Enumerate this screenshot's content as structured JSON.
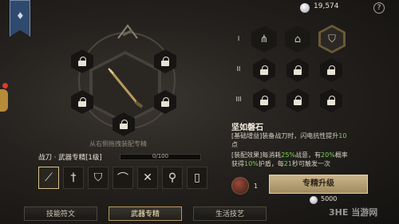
{
  "currency": {
    "value": "19,574",
    "icon": "silver-coin-icon"
  },
  "help": {
    "label": "?"
  },
  "ring": {
    "hint": "从右侧拖拽装配专精"
  },
  "spec": {
    "title": "战刀 · 武器专精[1级]",
    "progress_text": "0/100",
    "progress_value": 0,
    "weapons": [
      "blade",
      "sword",
      "shield",
      "bow",
      "crossed-swords",
      "staff",
      "scroll"
    ]
  },
  "tiers": [
    {
      "mark": "I"
    },
    {
      "mark": "II"
    },
    {
      "mark": "III"
    }
  ],
  "skill": {
    "name": "坚如磐石",
    "desc1_a": "[基础增益]装备战刀时，闪电抗性提升",
    "desc1_b": "10",
    "desc1_c": "点",
    "desc2_a": "[装配效果]每消耗",
    "desc2_b": "25%",
    "desc2_c": "战意，有",
    "desc2_d": "20%",
    "desc2_e": "概率",
    "desc3_a": "获得",
    "desc3_b": "10%",
    "desc3_c": "护盾，每",
    "desc3_d": "21",
    "desc3_e": "秒可触发一次"
  },
  "upgrade": {
    "item_count": "1",
    "button": "专精升级",
    "cost": "5000"
  },
  "tabs": [
    "技能符文",
    "武器专精",
    "生活技艺"
  ],
  "watermark": "3HE 当游网",
  "colors": {
    "accent_gold": "#cbb58a",
    "highlight_green": "#7ed257"
  }
}
